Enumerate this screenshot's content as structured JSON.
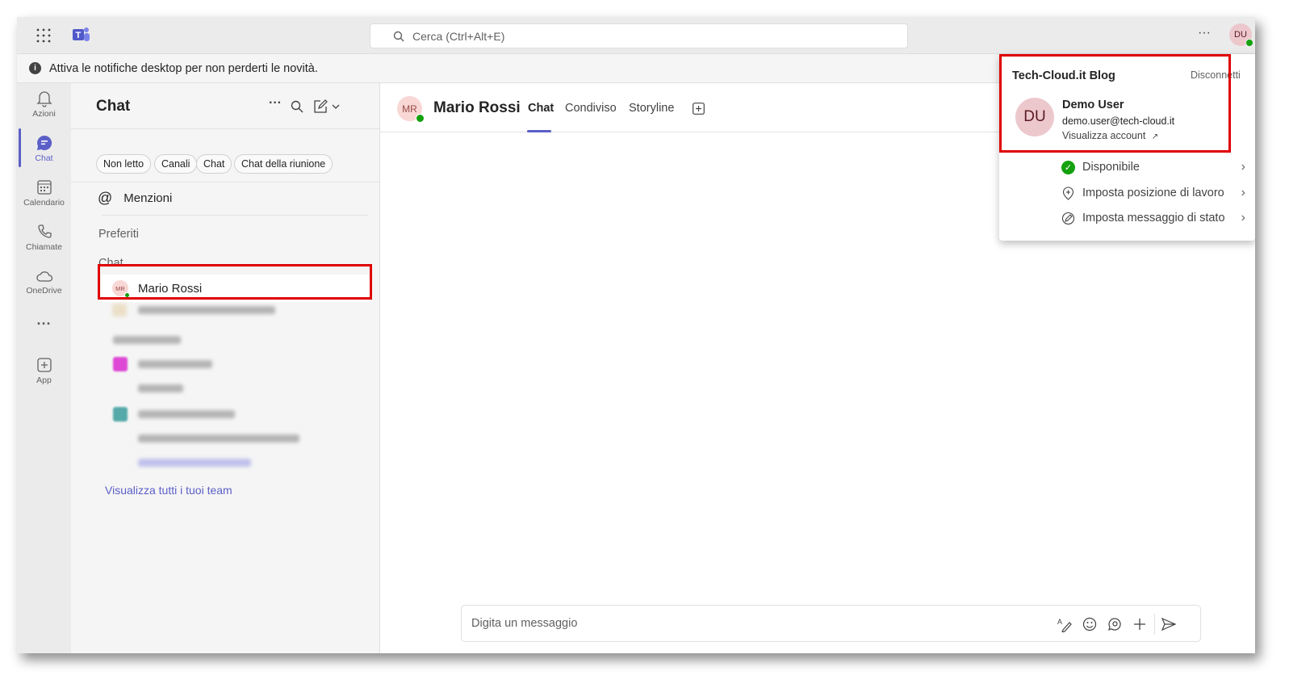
{
  "topbar": {
    "search_placeholder": "Cerca (Ctrl+Alt+E)",
    "more": "···",
    "avatar": "DU"
  },
  "notification": "Attiva le notifiche desktop per non perderti le novità.",
  "rail": [
    {
      "label": "Azioni"
    },
    {
      "label": "Chat"
    },
    {
      "label": "Calendario"
    },
    {
      "label": "Chiamate"
    },
    {
      "label": "OneDrive"
    },
    {
      "label": "···"
    },
    {
      "label": "App"
    }
  ],
  "panel": {
    "title": "Chat",
    "filters": [
      "Non letto",
      "Canali",
      "Chat",
      "Chat della riunione"
    ],
    "mentions": "Menzioni",
    "favorites": "Preferiti",
    "chat_section": "Chat",
    "contact": {
      "initials": "MR",
      "name": "Mario Rossi"
    },
    "see_all_teams": "Visualizza tutti i tuoi team"
  },
  "header": {
    "initials": "MR",
    "name": "Mario Rossi",
    "tabs": [
      "Chat",
      "Condiviso",
      "Storyline"
    ]
  },
  "compose": {
    "placeholder": "Digita un messaggio"
  },
  "popup": {
    "org": "Tech-Cloud.it Blog",
    "signout": "Disconnetti",
    "initials": "DU",
    "name": "Demo User",
    "email": "demo.user@tech-cloud.it",
    "view_account": "Visualizza account",
    "items": [
      "Disponibile",
      "Imposta posizione di lavoro",
      "Imposta messaggio di stato"
    ]
  },
  "colors": {
    "accent": "#5b5fc7",
    "available": "#13a10e",
    "highlight": "#e00000"
  }
}
